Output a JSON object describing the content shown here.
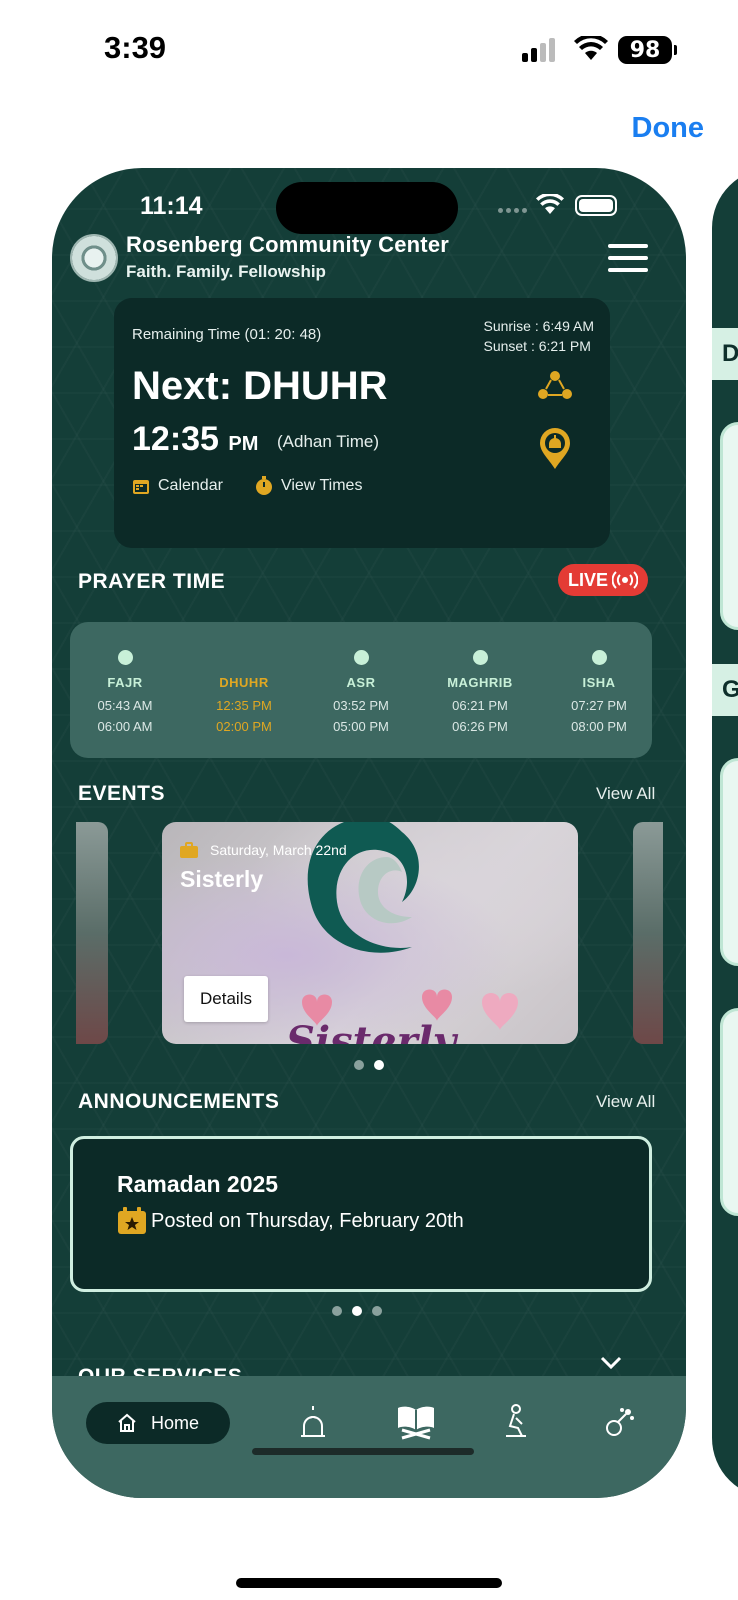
{
  "os_status": {
    "time": "3:39",
    "battery": "98"
  },
  "modal": {
    "done_label": "Done"
  },
  "app": {
    "status": {
      "time": "11:14"
    },
    "header": {
      "org_name": "Rosenberg Community Center",
      "tagline": "Faith. Family. Fellowship"
    },
    "next_prayer": {
      "remaining": "Remaining Time (01: 20: 48)",
      "sunrise": "Sunrise : 6:49 AM",
      "sunset": "Sunset : 6:21 PM",
      "title": "Next: DHUHR",
      "time": "12:35",
      "ampm": "PM",
      "adhan_note": "(Adhan Time)",
      "calendar_label": "Calendar",
      "view_times_label": "View Times"
    },
    "prayer_section": {
      "title": "PRAYER TIME",
      "live_label": "LIVE",
      "prayers": [
        {
          "name": "FAJR",
          "adhan": "05:43 AM",
          "iqamah": "06:00 AM",
          "active": false
        },
        {
          "name": "DHUHR",
          "adhan": "12:35 PM",
          "iqamah": "02:00 PM",
          "active": true
        },
        {
          "name": "ASR",
          "adhan": "03:52 PM",
          "iqamah": "05:00 PM",
          "active": false
        },
        {
          "name": "MAGHRIB",
          "adhan": "06:21 PM",
          "iqamah": "06:26 PM",
          "active": false
        },
        {
          "name": "ISHA",
          "adhan": "07:27 PM",
          "iqamah": "08:00 PM",
          "active": false
        }
      ]
    },
    "events": {
      "title": "EVENTS",
      "view_all": "View All",
      "card": {
        "date": "Saturday, March 22nd",
        "title": "Sisterly",
        "details_label": "Details",
        "image_word": "Sisterly"
      },
      "pager": {
        "count": 2,
        "active": 2
      }
    },
    "announcements": {
      "title": "ANNOUNCEMENTS",
      "view_all": "View All",
      "card": {
        "title": "Ramadan 2025",
        "posted": "Posted on Thursday, February 20th"
      },
      "pager": {
        "count": 3,
        "active": 2
      }
    },
    "services": {
      "title": "OUR SERVICES"
    },
    "tabbar": {
      "home_label": "Home",
      "tabs": [
        "home-icon",
        "mosque-icon",
        "quran-icon",
        "prayer-icon",
        "tasbih-icon"
      ]
    },
    "next_screen": {
      "band1": "D",
      "band2": "G"
    }
  },
  "colors": {
    "background": "#143e38",
    "card": "#0c2a27",
    "panel": "#3d6861",
    "accent": "#e0a722",
    "live": "#e43b35",
    "link": "#1a7ef0"
  }
}
